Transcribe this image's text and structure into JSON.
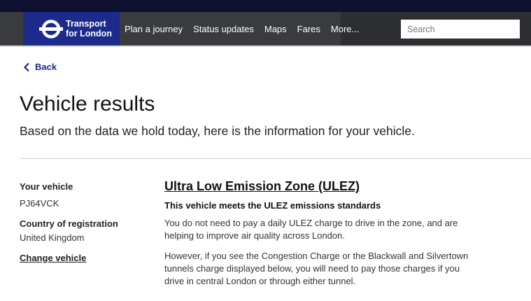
{
  "brand": {
    "name": "Transport for London",
    "line1": "Transport",
    "line2": "for London"
  },
  "nav": {
    "items": [
      "Plan a journey",
      "Status updates",
      "Maps",
      "Fares",
      "More..."
    ]
  },
  "search": {
    "placeholder": "Search"
  },
  "back": {
    "label": "Back"
  },
  "page": {
    "title": "Vehicle results",
    "intro": "Based on the data we hold today, here is the information for your vehicle."
  },
  "vehicle": {
    "your_vehicle_label": "Your vehicle",
    "registration": "PJ64VCK",
    "country_label": "Country of registration",
    "country": "United Kingdom",
    "change_label": "Change vehicle"
  },
  "ulez": {
    "title": "Ultra Low Emission Zone (ULEZ)",
    "status": "This vehicle meets the ULEZ emissions standards",
    "para1": "You do not need to pay a daily ULEZ charge to drive in the zone, and are helping to improve air quality across London.",
    "para2": "However, if you see the Congestion Charge or the Blackwall and Silvertown tunnels charge displayed below, you will need to pay those charges if you drive in central London or through either tunnel."
  },
  "colors": {
    "brand_blue": "#1c2a8c",
    "nav_bg": "#3a3b3e",
    "top_strip": "#0d1030"
  }
}
